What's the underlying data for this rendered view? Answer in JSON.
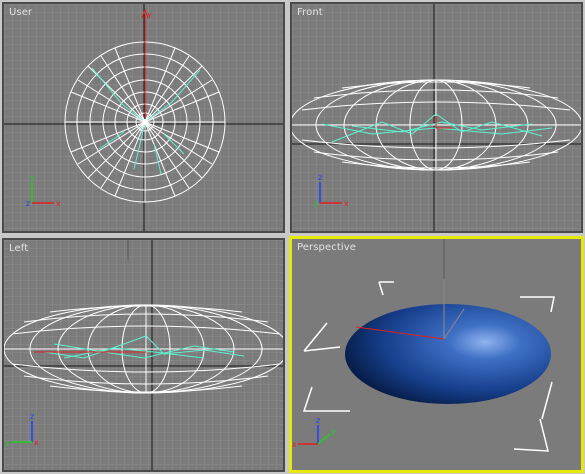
{
  "viewports": {
    "user": {
      "label": "User"
    },
    "front": {
      "label": "Front"
    },
    "left": {
      "label": "Left"
    },
    "perspective": {
      "label": "Perspective"
    }
  },
  "axes": {
    "x": "x",
    "y": "y",
    "z": "z"
  },
  "colors": {
    "viewport_bg": "#7b7b7b",
    "grid": "#8c8c8c",
    "world_axis": "#1a1a1a",
    "wireframe": "#ffffff",
    "spline": "#5ef0d0",
    "axis_x": "#e02020",
    "axis_y": "#20d020",
    "axis_z": "#2040ff",
    "active_border": "#e8e80a",
    "sphere": "#1c4ea0"
  },
  "icons": [
    "axis-tripod-icon",
    "gizmo-icon"
  ]
}
